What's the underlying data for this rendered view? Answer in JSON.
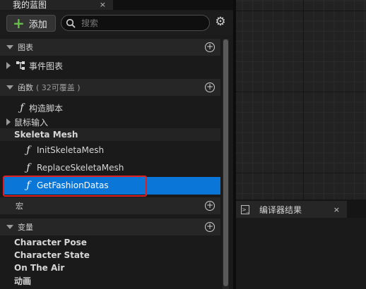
{
  "tab": {
    "title": "我的蓝图",
    "close": "×"
  },
  "toolbar": {
    "add_label": "添加",
    "search_placeholder": "搜索"
  },
  "sections": {
    "graphs": {
      "label": "图表"
    },
    "functions": {
      "label": "函数",
      "sub": "( 32可覆盖 )"
    },
    "macros": {
      "label": "宏"
    },
    "variables": {
      "label": "变量"
    }
  },
  "graph_items": {
    "event_graph": "事件图表"
  },
  "function_items": {
    "construction": "构造脚本",
    "mouse_input": "鼠标输入",
    "category": "Skeleta Mesh",
    "items": [
      "InitSkeletaMesh",
      "ReplaceSkeletaMesh",
      "GetFashionDatas"
    ]
  },
  "variable_categories": [
    "Character Pose",
    "Character State",
    "On The Air",
    "动画"
  ],
  "compiler_tab": {
    "title": "编译器结果",
    "close": "×"
  },
  "icons": {
    "add": "plus-icon",
    "search": "search-icon",
    "settings": "gear-icon",
    "function": "function-icon"
  },
  "colors": {
    "selection": "#0a77d8",
    "highlight_box": "#e02020",
    "add_plus": "#68c04a"
  }
}
